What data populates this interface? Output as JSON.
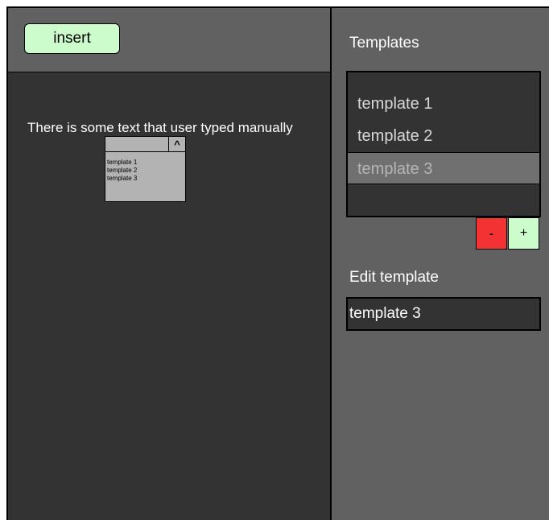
{
  "toolbar": {
    "insert_label": "insert"
  },
  "editor": {
    "typed_text": "There is some text that user typed manually",
    "inline_dropdown": {
      "toggle_glyph": "^",
      "items": [
        "template 1",
        "template 2",
        "template 3"
      ]
    }
  },
  "templates_panel": {
    "title": "Templates",
    "items": [
      {
        "label": "template 1",
        "selected": false
      },
      {
        "label": "template 2",
        "selected": false
      },
      {
        "label": "template 3",
        "selected": true
      }
    ],
    "remove_label": "-",
    "add_label": "+"
  },
  "edit_panel": {
    "title": "Edit template",
    "value": "template 3"
  },
  "colors": {
    "editor_bg": "#333333",
    "panel_bg": "#616161",
    "insert_button": "#ccfccc",
    "remove_button": "#f33333",
    "add_button": "#ccfccc",
    "selected_item": "#707070"
  }
}
